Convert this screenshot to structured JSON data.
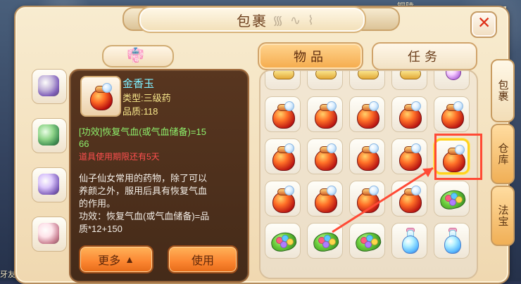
{
  "window": {
    "title": "包裹"
  },
  "world": {
    "top_label": "铜陵",
    "left_label": "牙友",
    "right_label": "1"
  },
  "tabs": {
    "items": [
      "物品",
      "任务"
    ]
  },
  "side_tabs": {
    "items": [
      "包裹",
      "仓库",
      "法宝"
    ]
  },
  "tooltip": {
    "name": "金香玉",
    "type": "类型:三级药",
    "quality": "品质:118",
    "effect_line_1": "[功效]恢复气血(或气血储备)=15",
    "effect_line_2": "66",
    "expire": "道具使用期限还有5天",
    "desc_1": "仙子仙女常用的药物，除了可以",
    "desc_2": "养颜之外，服用后具有恢复气血",
    "desc_3": "的作用。",
    "desc_4": "功效：恢复气血(或气血储备)=品",
    "desc_5": "质*12+150",
    "more_label": "更多",
    "use_label": "使用"
  },
  "icons": {
    "close": "close-icon",
    "outfit": "outfit-icon",
    "more": "chevron-up-icon"
  },
  "colors": {
    "highlight_box": "#ff4a35",
    "selected_cell": "#ffd21f",
    "tooltip_name": "#7ff0ff",
    "tooltip_effect": "#8ef16d"
  }
}
